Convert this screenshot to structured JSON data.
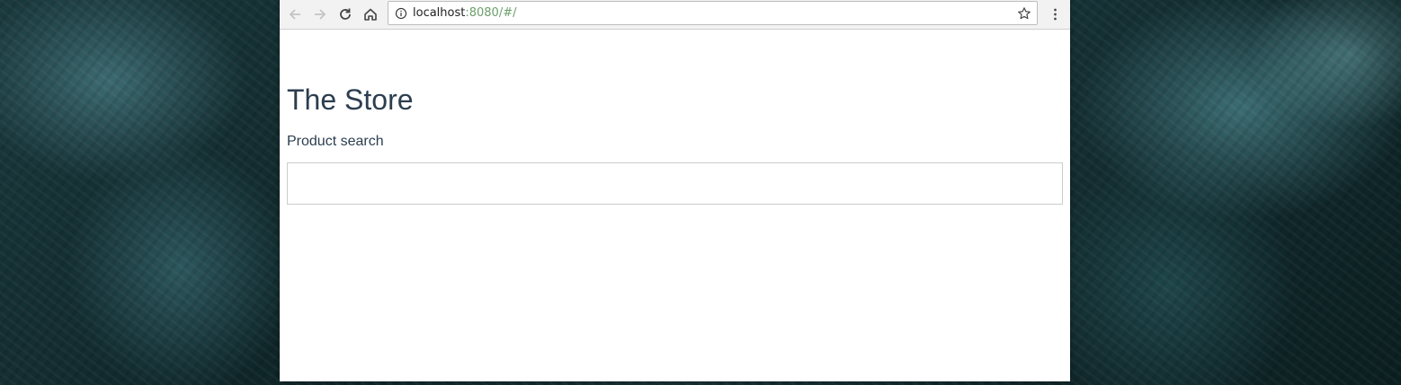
{
  "browser": {
    "url_host": "localhost",
    "url_rest": ":8080/#/",
    "icons": {
      "back": "arrow-left-icon",
      "forward": "arrow-right-icon",
      "reload": "reload-icon",
      "home": "home-icon",
      "info": "info-icon",
      "bookmark": "star-icon",
      "menu": "kebab-menu-icon"
    }
  },
  "page": {
    "title": "The Store",
    "search_label": "Product search",
    "search_value": ""
  },
  "colors": {
    "heading": "#2c3e50",
    "url_port": "#6b9f6b"
  }
}
